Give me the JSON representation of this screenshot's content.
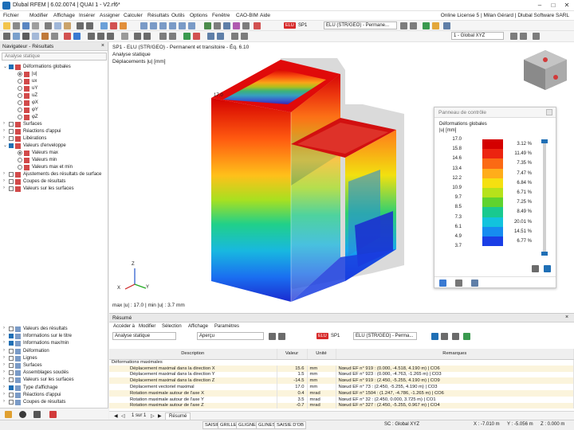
{
  "app": {
    "title": "Dlubal RFEM | 6.02.0074 | QUAI 1 - V2.rf6*"
  },
  "menu": {
    "items": [
      "Fichier",
      "Modifier",
      "Affichage",
      "Insérer",
      "Assigner",
      "Calculer",
      "Résultats",
      "Outils",
      "Options",
      "Fenêtre",
      "CAO-BIM",
      "Aide"
    ],
    "license": "Online License 5 | Milan Gérard | Dlubal Software SARL"
  },
  "toolbar": {
    "lc_badge": "ELU",
    "lc_id": "SP1",
    "lc_combo": "ELU (STR/GEO) - Permane...",
    "coord_combo": "1 - Global XYZ"
  },
  "navigator": {
    "title": "Navigateur - Résultats",
    "analysis": "Analyse statique",
    "tree": [
      {
        "label": "Déformations globales",
        "type": "group-open"
      },
      {
        "label": "|u|",
        "type": "radio-on"
      },
      {
        "label": "ux",
        "type": "radio"
      },
      {
        "label": "uY",
        "type": "radio"
      },
      {
        "label": "uZ",
        "type": "radio"
      },
      {
        "label": "φX",
        "type": "radio"
      },
      {
        "label": "φY",
        "type": "radio"
      },
      {
        "label": "φZ",
        "type": "radio"
      },
      {
        "label": "Surfaces",
        "type": "group"
      },
      {
        "label": "Réactions d'appui",
        "type": "group"
      },
      {
        "label": "Libérations",
        "type": "group"
      },
      {
        "label": "Valeurs d'enveloppe",
        "type": "group-open"
      },
      {
        "label": "Valeurs max",
        "type": "radio-on"
      },
      {
        "label": "Valeurs min",
        "type": "radio"
      },
      {
        "label": "Valeurs max et min",
        "type": "radio"
      },
      {
        "label": "Ajustements des résultats de surface",
        "type": "group"
      },
      {
        "label": "Coupes de résultats",
        "type": "group"
      },
      {
        "label": "Valeurs sur les surfaces",
        "type": "group"
      }
    ],
    "bottom_tree": [
      {
        "label": "Valeurs des résultats",
        "on": false
      },
      {
        "label": "Informations sur le titre",
        "on": true
      },
      {
        "label": "Informations max/min",
        "on": true
      },
      {
        "label": "Déformation",
        "on": false
      },
      {
        "label": "Lignes",
        "on": false
      },
      {
        "label": "Surfaces",
        "on": false
      },
      {
        "label": "Assemblages soudés",
        "on": false
      },
      {
        "label": "Valeurs sur les surfaces",
        "on": false
      },
      {
        "label": "Type d'affichage",
        "on": true
      },
      {
        "label": "Réactions d'appui",
        "on": false
      },
      {
        "label": "Coupes de résultats",
        "on": false
      }
    ]
  },
  "view": {
    "line1": "SP1 - ELU (STR/GEO) - Permanent et transitoire - Éq. 6.10",
    "line2": "Analyse statique",
    "line3": "Déplacements |u| [mm]",
    "footer": "max |u| : 17.0 | min |u| : 3.7 mm",
    "axis_x": "X",
    "axis_y": "Y",
    "axis_z": "Z"
  },
  "control_panel": {
    "title": "Panneau de contrôle",
    "heading": "Déformations globales",
    "unit": "|u| [mm]",
    "legend": [
      {
        "value": "17.0",
        "color": "#d40000",
        "pct": "3.12 %"
      },
      {
        "value": "15.8",
        "color": "#ec2410",
        "pct": "11.49 %"
      },
      {
        "value": "14.6",
        "color": "#fb6a14",
        "pct": "7.35 %"
      },
      {
        "value": "13.4",
        "color": "#ffad1a",
        "pct": "7.47 %"
      },
      {
        "value": "12.2",
        "color": "#f5e010",
        "pct": "6.84 %"
      },
      {
        "value": "10.9",
        "color": "#b6e21a",
        "pct": "6.71 %"
      },
      {
        "value": "9.7",
        "color": "#5fd32e",
        "pct": "7.25 %"
      },
      {
        "value": "8.5",
        "color": "#19c98f",
        "pct": "8.49 %"
      },
      {
        "value": "7.3",
        "color": "#12c3dd",
        "pct": "20.01 %"
      },
      {
        "value": "6.1",
        "color": "#168cf0",
        "pct": "14.51 %"
      },
      {
        "value": "4.9",
        "color": "#1a3ee6",
        "pct": "6.77 %"
      },
      {
        "value": "3.7",
        "color": "#1a1aa0",
        "pct": ""
      }
    ]
  },
  "results": {
    "title": "Résumé",
    "menu": [
      "Accéder à",
      "Modifier",
      "Sélection",
      "Affichage",
      "Paramètres"
    ],
    "analysis": "Analyse statique",
    "view_combo": "Aperçu",
    "lc_badge": "ELU",
    "lc_id": "SP1",
    "lc_combo": "ELU (STR/GEO) - Perma...",
    "columns": [
      "Description",
      "Valeur",
      "Unité",
      "Remarques"
    ],
    "group": "Déformations maximales",
    "rows": [
      {
        "d": "Déplacement maximal dans la direction X",
        "v": "15.6",
        "u": "mm",
        "r": "Nœud EF n° 919 : (0.000, -4.518, 4.190 m) | CO6"
      },
      {
        "d": "Déplacement maximal dans la direction Y",
        "v": "1.5",
        "u": "mm",
        "r": "Nœud EF n° 923 : (0.000, -4.763, -1.265 m) | CO3"
      },
      {
        "d": "Déplacement maximal dans la direction Z",
        "v": "-14.5",
        "u": "mm",
        "r": "Nœud EF n° 919 : (2.450, -5.255, 4.190 m) | CO9"
      },
      {
        "d": "Déplacement vectoriel maximal",
        "v": "17.0",
        "u": "mm",
        "r": "Nœud EF n° 73 : (2.450, -5.255, 4.190 m) | CO3"
      },
      {
        "d": "Rotation maximale autour de l'axe X",
        "v": "0.4",
        "u": "mrad",
        "r": "Nœud EF n° 1504 : (1.247, -4.786, -1.265 m) | CO6"
      },
      {
        "d": "Rotation maximale autour de l'axe Y",
        "v": "3.5",
        "u": "mrad",
        "r": "Nœud EF n° 32 : (2.450, 0.000, 3.725 m) | CO1"
      },
      {
        "d": "Rotation maximale autour de l'axe Z",
        "v": "-0.7",
        "u": "mrad",
        "r": "Nœud EF n° 327 : (2.450, -5.255, 0.967 m) | CO4"
      }
    ],
    "pager": "1 sur 1",
    "tab": "Résumé"
  },
  "status": {
    "buttons": [
      "SAISIE",
      "GRILLE",
      "GLIGNES",
      "GLINES",
      "SAISIE D'OB"
    ],
    "cs": "SC : Global XYZ",
    "plan": "Plan : XY",
    "x": "X : -7.010 m",
    "y": "Y : -5.056 m",
    "z": "Z : 0.000 m"
  }
}
